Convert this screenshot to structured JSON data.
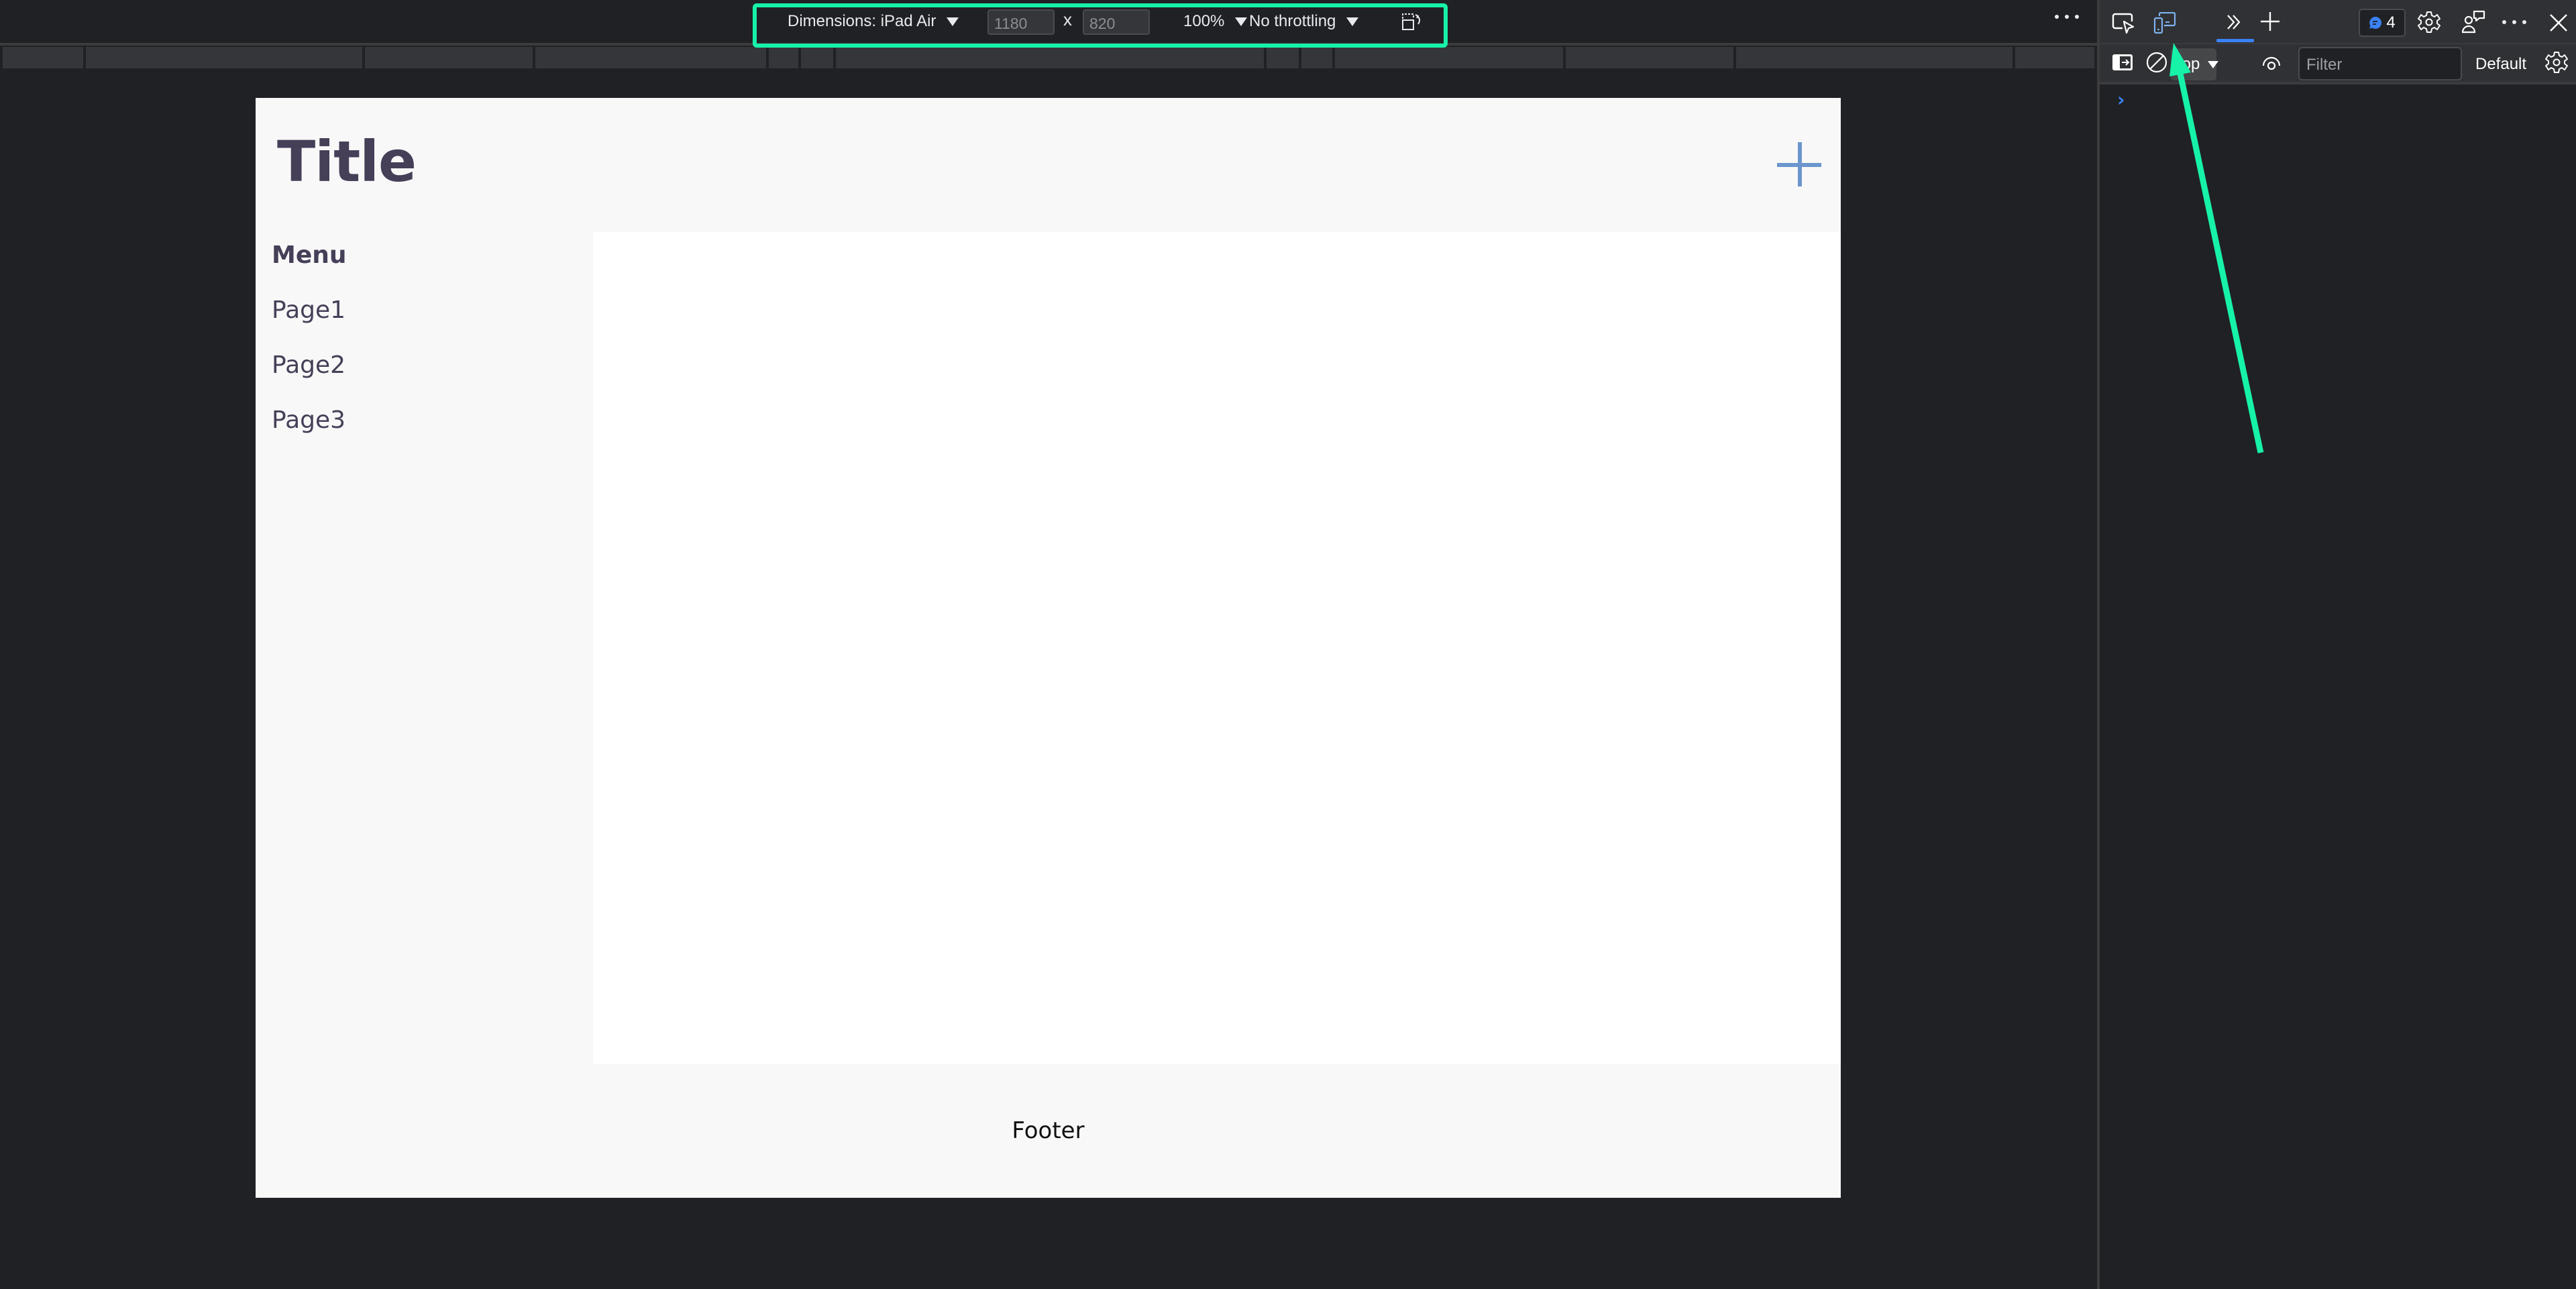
{
  "device_toolbar": {
    "dimensions_label": "Dimensions: iPad Air",
    "width_value": "1180",
    "times_symbol": "x",
    "height_value": "820",
    "zoom_label": "100%",
    "throttling_label": "No throttling",
    "rotate_icon": "rotate-device-icon",
    "more_icon": "more-options-icon"
  },
  "page": {
    "title": "Title",
    "add_icon": "plus-icon",
    "add_icon_color": "#6b96cd",
    "sidebar": {
      "heading": "Menu",
      "items": [
        {
          "label": "Page1"
        },
        {
          "label": "Page2"
        },
        {
          "label": "Page3"
        }
      ]
    },
    "footer": "Footer",
    "text_color": "#463f58"
  },
  "devtools": {
    "tabs": [
      {
        "icon": "inspect-element-icon"
      },
      {
        "icon": "device-emulation-icon",
        "active": true
      },
      {
        "icon": "more-tabs-icon"
      },
      {
        "icon": "add-tab-icon"
      }
    ],
    "issues_count": "4",
    "console": {
      "context": "top",
      "filter_placeholder": "Filter",
      "levels": "Default",
      "prompt": "›"
    }
  },
  "annotation": {
    "color": "#16f2a8"
  }
}
